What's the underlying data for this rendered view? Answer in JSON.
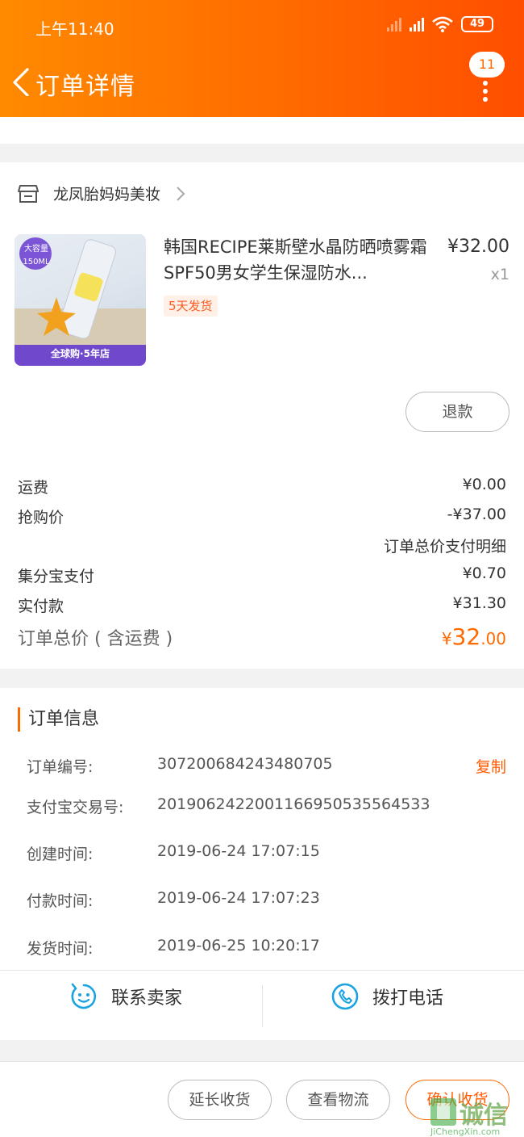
{
  "status_bar": {
    "time": "上午11:40",
    "battery": "49"
  },
  "header": {
    "title": "订单详情",
    "badge_count": "11"
  },
  "shop": {
    "name": "龙凤胎妈妈美妆"
  },
  "product": {
    "name": "韩国RECIPE莱斯壁水晶防晒喷雾霜SPF50男女学生保湿防水...",
    "price": "¥32.00",
    "quantity": "x1",
    "tag": "5天发货",
    "image_labels": {
      "capacity": "大容量",
      "volume": "150ML",
      "banner": "全球购·5年店"
    }
  },
  "refund_button": "退款",
  "price_rows": {
    "shipping": {
      "label": "运费",
      "value": "¥0.00"
    },
    "flash_price": {
      "label": "抢购价",
      "value": "-¥37.00"
    },
    "detail_link": "订单总价支付明细",
    "jifenbao": {
      "label": "集分宝支付",
      "value": "¥0.70"
    },
    "paid": {
      "label": "实付款",
      "value": "¥31.30"
    },
    "total": {
      "label": "订单总价 ( 含运费 )",
      "currency": "¥",
      "integer": "32",
      "decimal": ".00"
    }
  },
  "order_info": {
    "title": "订单信息",
    "copy_label": "复制",
    "order_no": {
      "label": "订单编号:",
      "value": "307200684243480705"
    },
    "alipay_no": {
      "label": "支付宝交易号:",
      "value": "2019062422001166950535564533"
    },
    "created": {
      "label": "创建时间:",
      "value": "2019-06-24 17:07:15"
    },
    "paid_time": {
      "label": "付款时间:",
      "value": "2019-06-24 17:07:23"
    },
    "shipped": {
      "label": "发货时间:",
      "value": "2019-06-25 10:20:17"
    }
  },
  "contact": {
    "seller": "联系卖家",
    "call": "拨打电话"
  },
  "actions": {
    "extend": "延长收货",
    "logistics": "查看物流",
    "confirm": "确认收货"
  },
  "watermark": {
    "text": "诚信",
    "url": "JiChengXin.com"
  },
  "colors": {
    "accent": "#ff6a00",
    "link_blue": "#1aa3e0"
  }
}
